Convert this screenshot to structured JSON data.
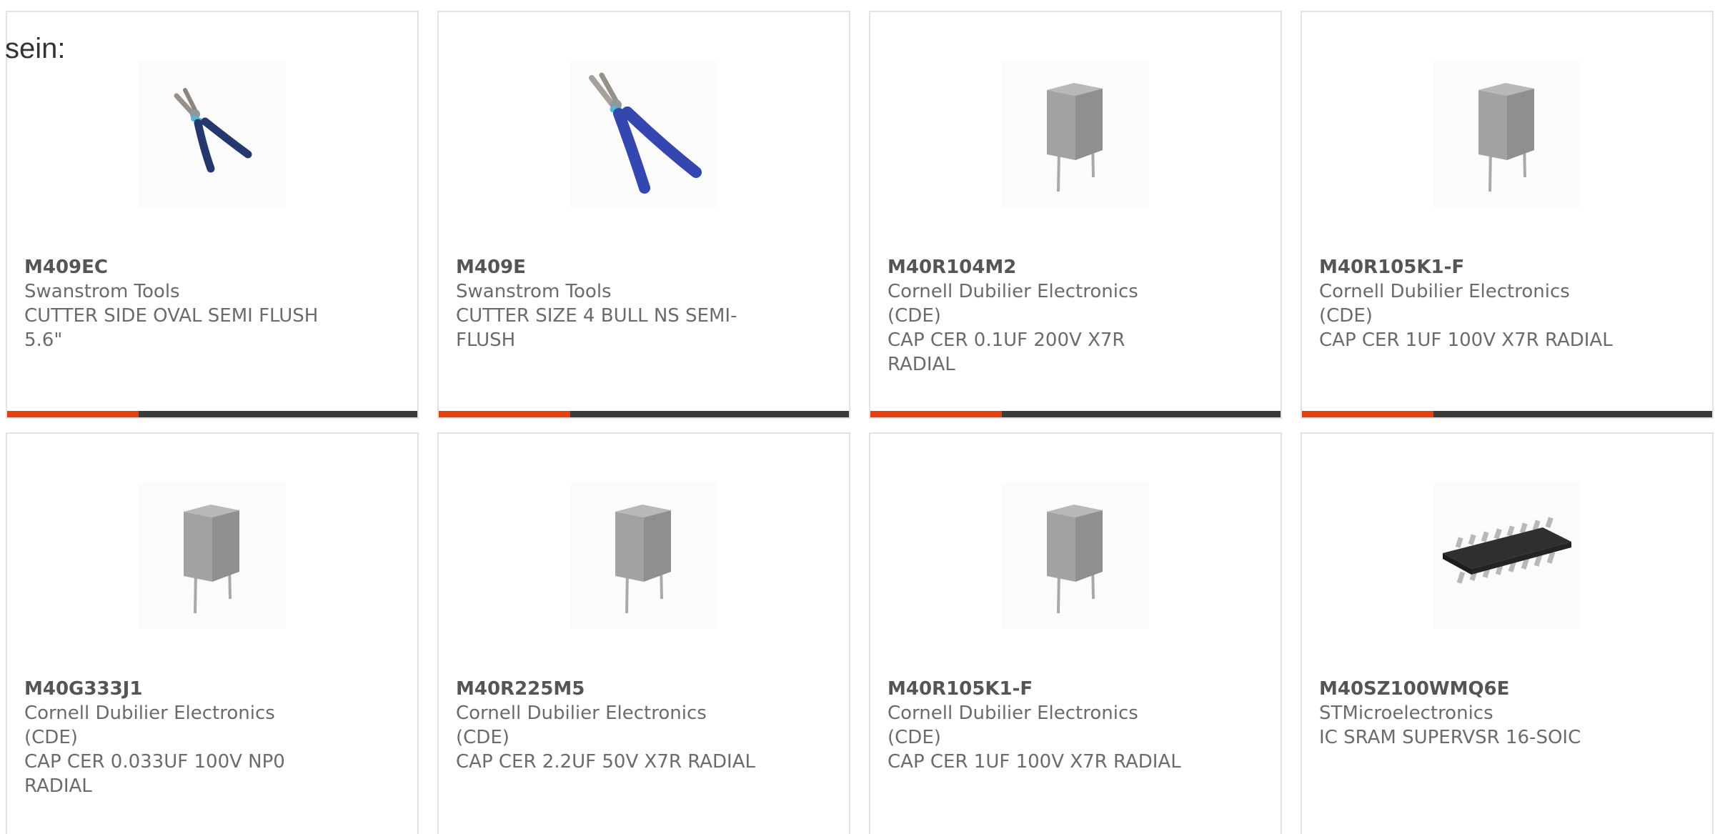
{
  "intro_text": "sein:",
  "accent_color": "#e8400c",
  "track_color": "#3b3b3b",
  "products": [
    {
      "part_number": "M409EC",
      "manufacturer": "Swanstrom Tools",
      "description": "CUTTER SIDE OVAL SEMI FLUSH 5.6\"",
      "image_icon": "side-cutter-small-icon",
      "progress": 0.32
    },
    {
      "part_number": "M409E",
      "manufacturer": "Swanstrom Tools",
      "description": "CUTTER SIZE 4 BULL NS SEMI-FLUSH",
      "image_icon": "side-cutter-large-icon",
      "progress": 0.32
    },
    {
      "part_number": "M40R104M2",
      "manufacturer": "Cornell Dubilier Electronics (CDE)",
      "description": "CAP CER 0.1UF 200V X7R RADIAL",
      "image_icon": "radial-capacitor-icon",
      "progress": 0.32
    },
    {
      "part_number": "M40R105K1-F",
      "manufacturer": "Cornell Dubilier Electronics (CDE)",
      "description": "CAP CER 1UF 100V X7R RADIAL",
      "image_icon": "radial-capacitor-icon",
      "progress": 0.32
    },
    {
      "part_number": "M40G333J1",
      "manufacturer": "Cornell Dubilier Electronics (CDE)",
      "description": "CAP CER 0.033UF 100V NP0 RADIAL",
      "image_icon": "radial-capacitor-icon",
      "progress": null
    },
    {
      "part_number": "M40R225M5",
      "manufacturer": "Cornell Dubilier Electronics (CDE)",
      "description": "CAP CER 2.2UF 50V X7R RADIAL",
      "image_icon": "radial-capacitor-icon",
      "progress": null
    },
    {
      "part_number": "M40R105K1-F",
      "manufacturer": "Cornell Dubilier Electronics (CDE)",
      "description": "CAP CER 1UF 100V X7R RADIAL",
      "image_icon": "radial-capacitor-icon",
      "progress": null
    },
    {
      "part_number": "M40SZ100WMQ6E",
      "manufacturer": "STMicroelectronics",
      "description": "IC SRAM SUPERVSR 16-SOIC",
      "image_icon": "soic-16-chip-icon",
      "progress": null
    }
  ]
}
